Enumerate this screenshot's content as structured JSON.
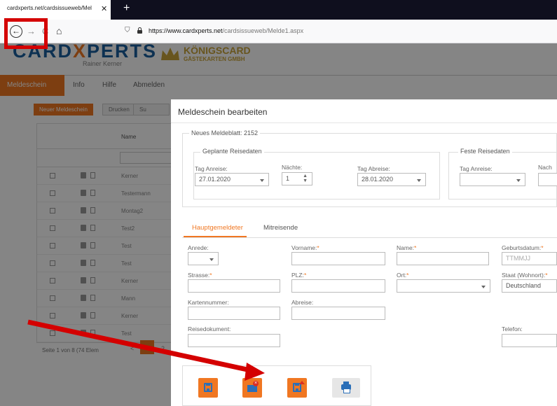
{
  "browser": {
    "tab_title": "cardxperts.net/cardsissueweb/Mel",
    "url_domain": "https://www.cardxperts.net",
    "url_path": "/cardsissueweb/Melde1.aspx"
  },
  "site": {
    "logo_main_1": "CARD",
    "logo_main_2": "X",
    "logo_main_3": "PERTS",
    "logo_sub": "Rainer Kerner",
    "partner_name": "KÖNIGSCARD",
    "partner_sub": "GÄSTEKARTEN GMBH"
  },
  "nav": {
    "items": [
      "Meldeschein",
      "Info",
      "Hilfe",
      "Abmelden"
    ]
  },
  "list": {
    "new_button": "Neuer Meldeschein",
    "print_button": "Drucken",
    "search_button": "Su",
    "name_header": "Name",
    "rows": [
      "Kerner",
      "Testermann",
      "Montag2",
      "Test2",
      "Test",
      "Test",
      "Kerner",
      "Mann",
      "Kerner",
      "Test"
    ],
    "footer": "Seite 1 von 8 (74 Elem",
    "page_prev": "<",
    "page_next": "2"
  },
  "modal": {
    "title": "Meldeschein bearbeiten",
    "legend_main": "Neues Meldeblatt: 2152",
    "legend_planned": "Geplante Reisedaten",
    "legend_fixed": "Feste Reisedaten",
    "arrival_label": "Tag Anreise:",
    "arrival_value": "27.01.2020",
    "nights_label": "Nächte:",
    "nights_value": "1",
    "departure_label": "Tag Abreise:",
    "departure_value": "28.01.2020",
    "fixed_arrival_label": "Tag Anreise:",
    "fixed_nights_label": "Nach",
    "tab_main": "Hauptgemeldeter",
    "tab_co": "Mitreisende",
    "salutation_label": "Anrede:",
    "firstname_label": "Vorname:",
    "lastname_label": "Name:",
    "birthdate_label": "Geburtsdatum:",
    "birthdate_placeholder": "TTMMJJ",
    "street_label": "Strasse:",
    "zip_label": "PLZ:",
    "city_label": "Ort:",
    "country_label": "Staat (Wohnort):",
    "country_value": "Deutschland",
    "cardnumber_label": "Kartennummer:",
    "departure2_label": "Abreise:",
    "traveldoc_label": "Reisedokument:",
    "phone_label": "Telefon:",
    "required_mark": "*"
  },
  "colors": {
    "accent": "#f07722",
    "brand_blue": "#1a5f9e",
    "annotation_red": "#d40000"
  }
}
